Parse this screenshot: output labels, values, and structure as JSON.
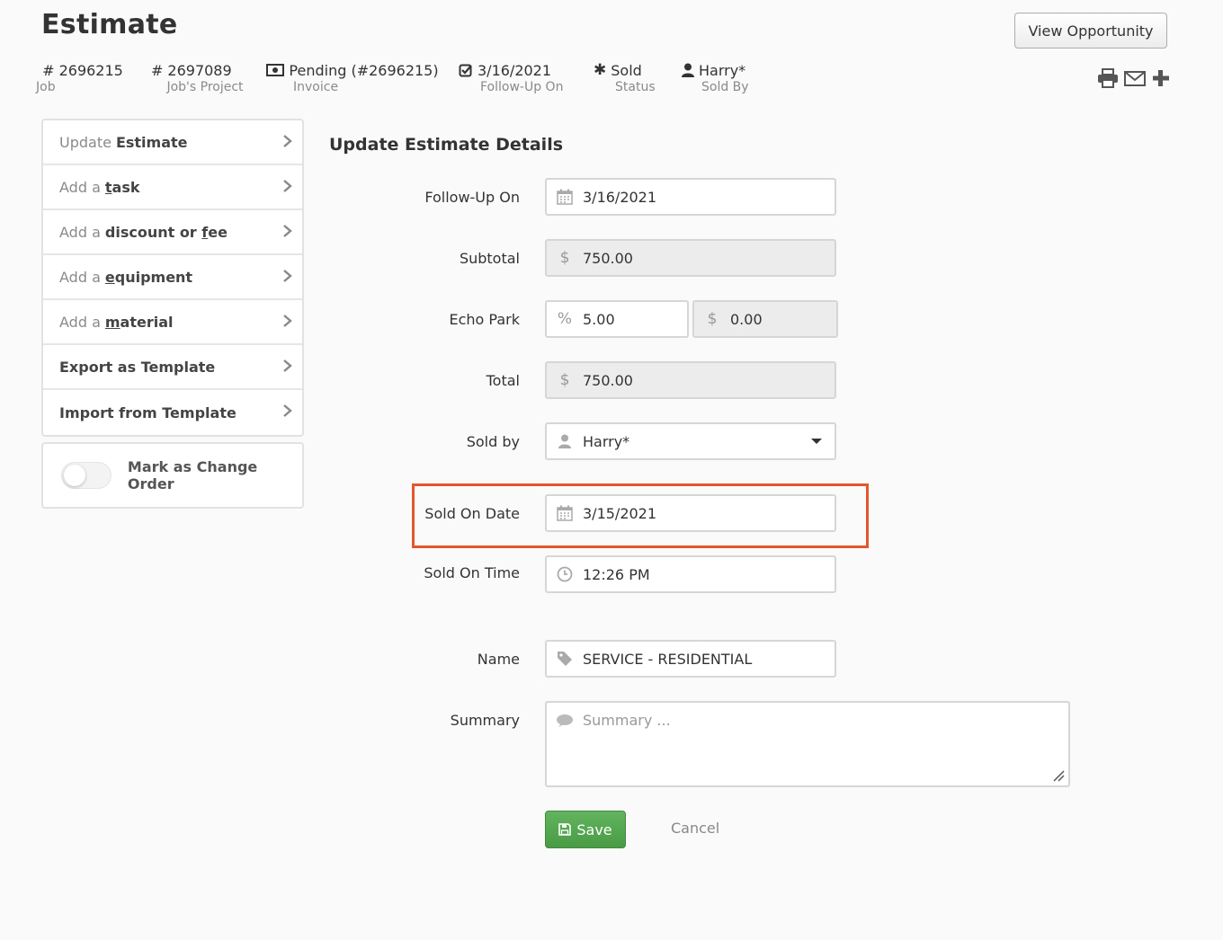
{
  "header": {
    "title": "Estimate",
    "view_opportunity_label": "View Opportunity",
    "meta": [
      {
        "prefix": "#",
        "value": "2696215",
        "label": "Job",
        "icon": "hash-icon"
      },
      {
        "prefix": "#",
        "value": "2697089",
        "label": "Job's Project",
        "icon": "hash-icon"
      },
      {
        "prefix": "",
        "value": "Pending (#2696215)",
        "label": "Invoice",
        "icon": "money-icon"
      },
      {
        "prefix": "",
        "value": "3/16/2021",
        "label": "Follow-Up On",
        "icon": "checkbox-icon"
      },
      {
        "prefix": "",
        "value": "Sold",
        "label": "Status",
        "icon": "asterisk-icon"
      },
      {
        "prefix": "",
        "value": "Harry*",
        "label": "Sold By",
        "icon": "user-icon"
      }
    ],
    "toolbar_icons": [
      "print-icon",
      "email-icon",
      "plus-icon"
    ]
  },
  "sidebar": {
    "items": [
      {
        "pre": "Update",
        "access_key": "",
        "rest": "Estimate"
      },
      {
        "pre": "Add a",
        "access_key": "t",
        "rest": "ask"
      },
      {
        "pre": "Add a",
        "text_before": "discount or ",
        "access_key": "f",
        "rest": "ee"
      },
      {
        "pre": "Add a",
        "access_key": "e",
        "rest": "quipment"
      },
      {
        "pre": "Add a",
        "access_key": "m",
        "rest": "aterial"
      },
      {
        "pre": "",
        "access_key": "",
        "rest": "Export as Template"
      },
      {
        "pre": "",
        "access_key": "",
        "rest": "Import from Template"
      }
    ],
    "change_order_label": "Mark as Change Order",
    "change_order_on": false
  },
  "form": {
    "section_title": "Update Estimate Details",
    "follow_up": {
      "label": "Follow-Up On",
      "value": "3/16/2021"
    },
    "subtotal": {
      "label": "Subtotal",
      "currency": "$",
      "value": "750.00"
    },
    "echo_park": {
      "label": "Echo Park",
      "percent_symbol": "%",
      "percent": "5.00",
      "currency": "$",
      "amount": "0.00"
    },
    "total": {
      "label": "Total",
      "currency": "$",
      "value": "750.00"
    },
    "sold_by": {
      "label": "Sold by",
      "value": "Harry*"
    },
    "sold_on_date": {
      "label": "Sold On Date",
      "value": "3/15/2021"
    },
    "sold_on_time": {
      "label": "Sold On Time",
      "value": "12:26 PM"
    },
    "name": {
      "label": "Name",
      "value": "SERVICE - RESIDENTIAL"
    },
    "summary": {
      "label": "Summary",
      "placeholder": "Summary ..."
    },
    "save_label": "Save",
    "cancel_label": "Cancel"
  },
  "colors": {
    "highlight": "#e4572e",
    "save_green": "#5cb85c"
  }
}
